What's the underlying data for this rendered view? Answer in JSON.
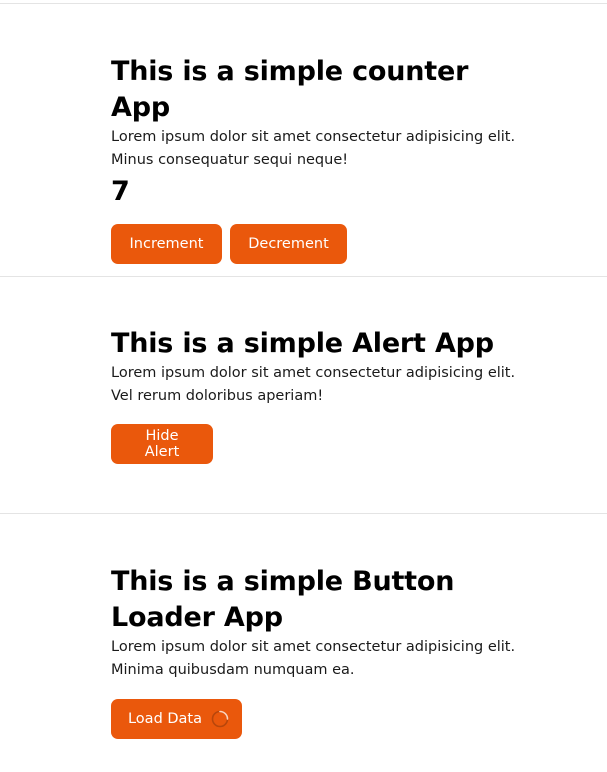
{
  "counter_app": {
    "title": "This is a simple counter App",
    "description_line1": "Lorem ipsum dolor sit amet consectetur adipisicing elit.",
    "description_line2": "Minus consequatur sequi neque!",
    "count": "7",
    "increment_label": "Increment",
    "decrement_label": "Decrement"
  },
  "alert_app": {
    "title": "This is a simple Alert App",
    "description_line1": "Lorem ipsum dolor sit amet consectetur adipisicing elit.",
    "description_line2": "Vel rerum doloribus aperiam!",
    "hide_label": "Hide Alert"
  },
  "loader_app": {
    "title_line1": "This is a simple Button",
    "title_line2": "Loader App",
    "description_line1": "Lorem ipsum dolor sit amet consectetur adipisicing elit.",
    "description_line2": "Minima quibusdam numquam ea.",
    "load_label": "Load Data",
    "spinner_icon": "loading-spinner"
  },
  "colors": {
    "accent": "#ea580c",
    "divider": "#e4e4e4"
  }
}
